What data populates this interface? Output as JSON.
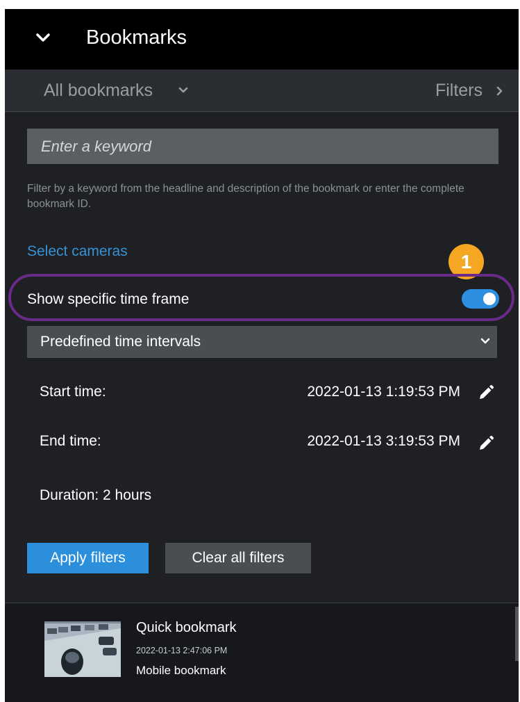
{
  "header": {
    "title": "Bookmarks"
  },
  "subheader": {
    "scope_label": "All bookmarks",
    "filters_label": "Filters"
  },
  "search": {
    "placeholder": "Enter a keyword",
    "value": "",
    "hint": "Filter by a keyword from the headline and description of the bookmark or enter the complete bookmark ID."
  },
  "cameras": {
    "link_label": "Select cameras"
  },
  "annotation": {
    "badge": "1"
  },
  "timeframe": {
    "toggle_label": "Show specific time frame",
    "enabled": true,
    "interval_select": "Predefined time intervals",
    "start_label": "Start time:",
    "start_value": "2022-01-13 1:19:53 PM",
    "end_label": "End time:",
    "end_value": "2022-01-13 3:19:53 PM",
    "duration": "Duration: 2 hours"
  },
  "actions": {
    "apply_label": "Apply filters",
    "clear_label": "Clear all filters"
  },
  "results": [
    {
      "title": "Quick bookmark",
      "time": "2022-01-13 2:47:06 PM",
      "description": "Mobile bookmark"
    }
  ],
  "colors": {
    "accent": "#2c8fdc",
    "link": "#3592d6",
    "badge": "#f5a623",
    "highlight_ring": "#6a2a8a",
    "panel_bg": "#1e2024"
  },
  "icons": [
    "chevron-down-icon",
    "chevron-right-icon",
    "pencil-icon"
  ]
}
